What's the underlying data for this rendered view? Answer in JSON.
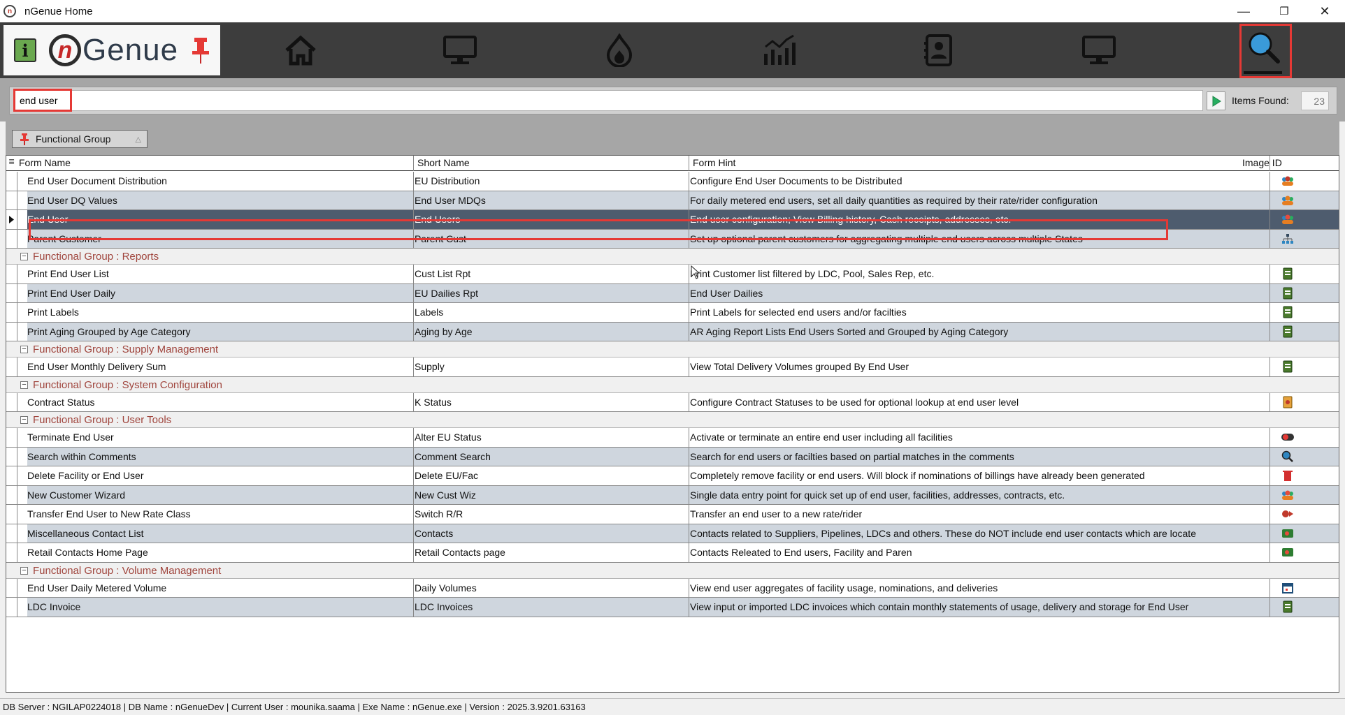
{
  "window": {
    "title": "nGenue Home",
    "minimize": "—",
    "restore": "❐",
    "close": "✕"
  },
  "toolbar": {
    "info": "i",
    "logo_n": "n",
    "logo_text": "Genue",
    "nav": [
      "home-icon",
      "monitor-icon",
      "flame-icon",
      "chart-icon",
      "contacts-icon",
      "desktop-icon",
      "search-icon"
    ]
  },
  "search": {
    "value": "end user",
    "items_found_label": "Items Found:",
    "items_found_count": "23"
  },
  "grouping": {
    "label": "Functional Group",
    "sort": "△"
  },
  "columns": {
    "form_name": "Form Name",
    "short_name": "Short Name",
    "form_hint": "Form Hint",
    "image_id": "Image ID"
  },
  "rows": [
    {
      "form_name": "End User Document Distribution",
      "short_name": "EU Distribution",
      "form_hint": "Configure End User Documents to be Distributed",
      "icon": "users-doc-icon",
      "color": "#c0392b"
    },
    {
      "form_name": "End User DQ Values",
      "short_name": "End User MDQs",
      "form_hint": "For daily metered end users, set all daily quantities as required by their rate/rider configuration",
      "icon": "users-chart-icon",
      "color": "#e67e22"
    },
    {
      "form_name": "End User",
      "short_name": "End Users",
      "form_hint": "End user configuration; View Billing history, Cash receipts, addresses, etc.",
      "icon": "users-icon",
      "color": "#e74c3c"
    },
    {
      "form_name": "Parent Customer",
      "short_name": "Parent Cust",
      "form_hint": "Set up optional parent customers for aggregating multiple end users across multiple States",
      "icon": "org-tree-icon",
      "color": "#34495e"
    }
  ],
  "groups": [
    {
      "label": "Functional Group : Reports",
      "rows": [
        {
          "form_name": "Print End User List",
          "short_name": "Cust List Rpt",
          "form_hint": "Print Customer list filtered by LDC, Pool, Sales Rep, etc.",
          "icon": "report-icon",
          "color": "#4a7a2c"
        },
        {
          "form_name": "Print End User Daily",
          "short_name": "EU Dailies Rpt",
          "form_hint": "End User Dailies",
          "icon": "report-icon",
          "color": "#4a7a2c"
        },
        {
          "form_name": "Print Labels",
          "short_name": "Labels",
          "form_hint": "Print Labels for selected end users and/or facilties",
          "icon": "report-icon",
          "color": "#4a7a2c"
        },
        {
          "form_name": "Print Aging Grouped by Age Category",
          "short_name": "Aging by Age",
          "form_hint": "AR Aging Report Lists End Users Sorted and Grouped by Aging Category",
          "icon": "report-icon",
          "color": "#4a7a2c"
        }
      ]
    },
    {
      "label": "Functional Group : Supply Management",
      "rows": [
        {
          "form_name": "End User Monthly Delivery Sum",
          "short_name": "Supply",
          "form_hint": "View Total Delivery Volumes grouped By End User",
          "icon": "report-icon",
          "color": "#4a7a2c"
        }
      ]
    },
    {
      "label": "Functional Group : System Configuration",
      "rows": [
        {
          "form_name": "Contract Status",
          "short_name": "K Status",
          "form_hint": "Configure Contract Statuses to be used for optional lookup at end user level",
          "icon": "contract-icon",
          "color": "#e6a23c"
        }
      ]
    },
    {
      "label": "Functional Group : User Tools",
      "rows": [
        {
          "form_name": "Terminate End User",
          "short_name": "Alter EU Status",
          "form_hint": "Activate or terminate an entire end user including all facilities",
          "icon": "toggle-icon",
          "color": "#333333"
        },
        {
          "form_name": "Search within Comments",
          "short_name": "Comment Search",
          "form_hint": "Search for end users or facilties based on partial matches in the comments",
          "icon": "magnifier-icon",
          "color": "#2e86c1"
        },
        {
          "form_name": "Delete Facility or End User",
          "short_name": "Delete EU/Fac",
          "form_hint": "Completely remove facility or end users. Will block if nominations of billings have already been generated",
          "icon": "trash-icon",
          "color": "#d32f2f"
        },
        {
          "form_name": "New Customer Wizard",
          "short_name": "New Cust Wiz",
          "form_hint": "Single data entry point for quick set up of end user, facilities, addresses, contracts, etc.",
          "icon": "users-icon",
          "color": "#e74c3c"
        },
        {
          "form_name": "Transfer End User to New Rate Class",
          "short_name": "Switch R/R",
          "form_hint": "Transfer an end user to a new rate/rider",
          "icon": "transfer-icon",
          "color": "#c0392b"
        },
        {
          "form_name": "Miscellaneous Contact List",
          "short_name": "Contacts",
          "form_hint": "Contacts related to Suppliers, Pipelines, LDCs and others. These do NOT include end user contacts which are locate",
          "icon": "contact-card-icon",
          "color": "#2e7d32"
        },
        {
          "form_name": "Retail Contacts Home Page",
          "short_name": "Retail Contacts page",
          "form_hint": "Contacts Releated to End users, Facility and Paren",
          "icon": "contact-card-icon",
          "color": "#2e7d32"
        }
      ]
    },
    {
      "label": "Functional Group : Volume Management",
      "rows": [
        {
          "form_name": "End User Daily Metered Volume",
          "short_name": "Daily Volumes",
          "form_hint": "View end user aggregates of facility usage, nominations, and deliveries",
          "icon": "calendar-icon",
          "color": "#1f4e79"
        },
        {
          "form_name": "LDC Invoice",
          "short_name": "LDC Invoices",
          "form_hint": "View input or imported LDC invoices which contain monthly statements of usage, delivery and storage for End User",
          "icon": "report-icon",
          "color": "#4a7a2c"
        }
      ]
    }
  ],
  "status": "DB Server : NGILAP0224018  |  DB Name : nGenueDev  |  Current User : mounika.saama  |  Exe Name : nGenue.exe  |  Version : 2025.3.9201.63163"
}
